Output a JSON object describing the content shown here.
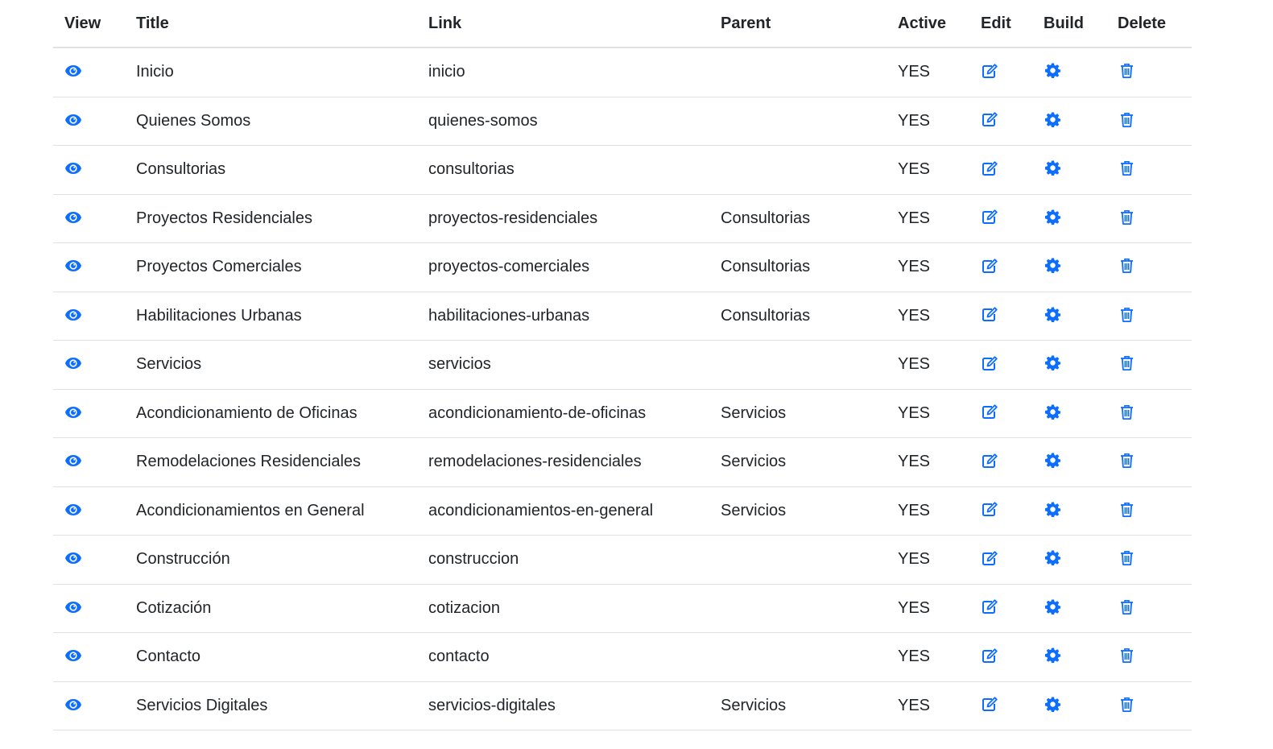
{
  "table": {
    "headers": {
      "view": "View",
      "title": "Title",
      "link": "Link",
      "parent": "Parent",
      "active": "Active",
      "edit": "Edit",
      "build": "Build",
      "delete": "Delete"
    },
    "icons": {
      "view": "eye-icon",
      "edit": "edit-icon",
      "build": "gear-icon",
      "delete": "trash-icon"
    },
    "accent_color": "#0d6efd",
    "rows": [
      {
        "title": "Inicio",
        "link": "inicio",
        "parent": "",
        "active": "YES"
      },
      {
        "title": "Quienes Somos",
        "link": "quienes-somos",
        "parent": "",
        "active": "YES"
      },
      {
        "title": "Consultorias",
        "link": "consultorias",
        "parent": "",
        "active": "YES"
      },
      {
        "title": "Proyectos Residenciales",
        "link": "proyectos-residenciales",
        "parent": "Consultorias",
        "active": "YES"
      },
      {
        "title": "Proyectos Comerciales",
        "link": "proyectos-comerciales",
        "parent": "Consultorias",
        "active": "YES"
      },
      {
        "title": "Habilitaciones Urbanas",
        "link": "habilitaciones-urbanas",
        "parent": "Consultorias",
        "active": "YES"
      },
      {
        "title": "Servicios",
        "link": "servicios",
        "parent": "",
        "active": "YES"
      },
      {
        "title": "Acondicionamiento de Oficinas",
        "link": "acondicionamiento-de-oficinas",
        "parent": "Servicios",
        "active": "YES"
      },
      {
        "title": "Remodelaciones Residenciales",
        "link": "remodelaciones-residenciales",
        "parent": "Servicios",
        "active": "YES"
      },
      {
        "title": "Acondicionamientos en General",
        "link": "acondicionamientos-en-general",
        "parent": "Servicios",
        "active": "YES"
      },
      {
        "title": "Construcción",
        "link": "construccion",
        "parent": "",
        "active": "YES"
      },
      {
        "title": "Cotización",
        "link": "cotizacion",
        "parent": "",
        "active": "YES"
      },
      {
        "title": "Contacto",
        "link": "contacto",
        "parent": "",
        "active": "YES"
      },
      {
        "title": "Servicios Digitales",
        "link": "servicios-digitales",
        "parent": "Servicios",
        "active": "YES"
      }
    ]
  }
}
